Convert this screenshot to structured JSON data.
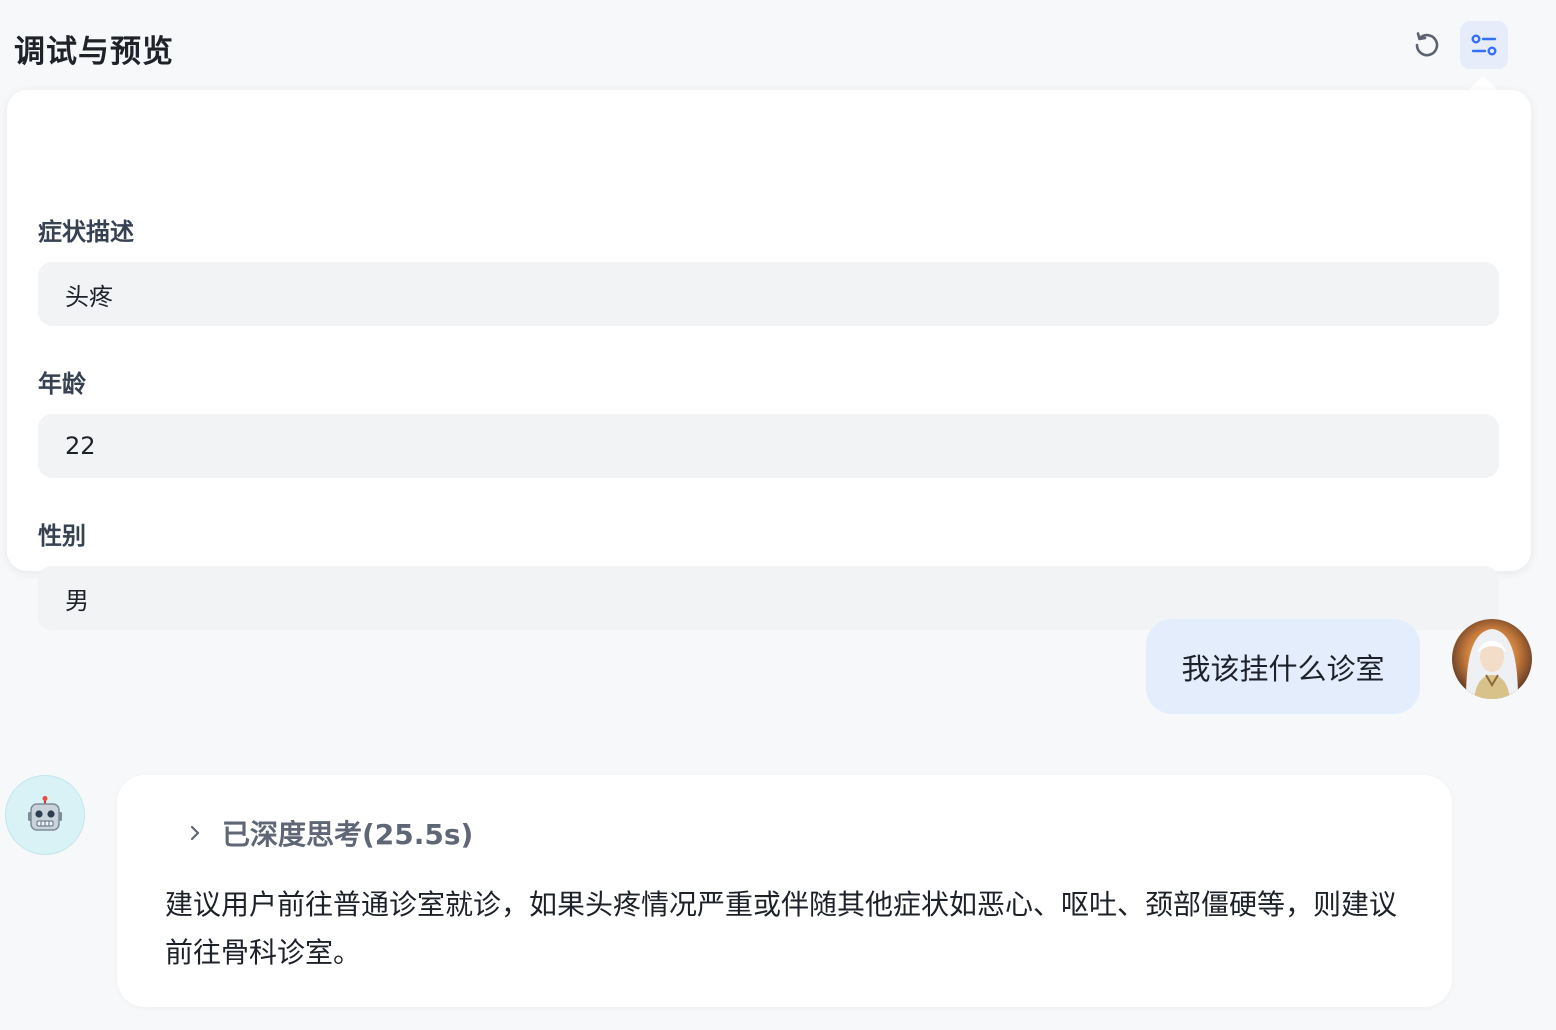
{
  "header": {
    "title": "调试与预览",
    "reset_icon": "refresh-icon",
    "settings_icon": "sliders-icon"
  },
  "variables": {
    "fields": [
      {
        "label": "症状描述",
        "value": "头疼"
      },
      {
        "label": "年龄",
        "value": "22"
      },
      {
        "label": "性别",
        "value": "男"
      }
    ]
  },
  "chat": {
    "user_message": "我该挂什么诊室",
    "bot_avatar_icon": "robot-icon",
    "thinking_label": "已深度思考(25.5s)",
    "bot_message": "建议用户前往普通诊室就诊，如果头疼情况严重或伴随其他症状如恶心、呕吐、颈部僵硬等，则建议前往骨科诊室。"
  },
  "colors": {
    "accent": "#3370ff",
    "user_bubble": "#e3edfb",
    "bot_avatar_bg": "#d8f2f6"
  }
}
